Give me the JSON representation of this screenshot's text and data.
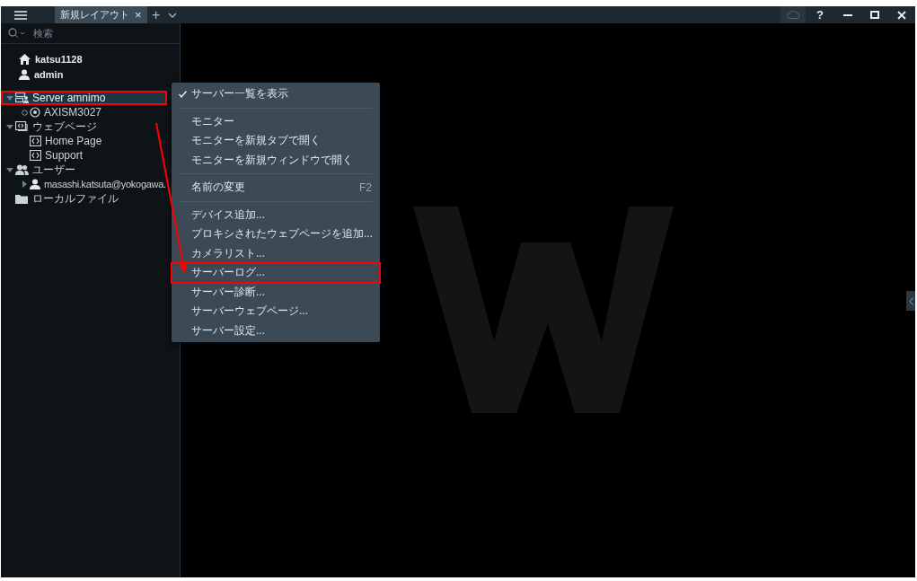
{
  "titlebar": {
    "tabs": [
      {
        "label": "新規レイアウト",
        "selected": true,
        "close": "×"
      }
    ],
    "add": "+",
    "help": "?"
  },
  "sidebar": {
    "search": {
      "placeholder": "検索"
    },
    "account": [
      {
        "kind": "home",
        "text": "katsu1128"
      },
      {
        "kind": "user",
        "text": "admin"
      }
    ],
    "tree": [
      {
        "kind": "server",
        "label": "Server amnimo",
        "expanded": true,
        "selected": true,
        "highlighted": true,
        "children": [
          {
            "kind": "camera",
            "label": "AXISM3027",
            "selected": false,
            "highlighted": false
          }
        ]
      },
      {
        "kind": "webpages",
        "label": "ウェブページ",
        "expanded": true,
        "selected": false,
        "highlighted": false,
        "children": [
          {
            "kind": "webpage",
            "label": "Home Page",
            "selected": false,
            "highlighted": false
          },
          {
            "kind": "webpage",
            "label": "Support",
            "selected": false,
            "highlighted": false
          }
        ]
      },
      {
        "kind": "users",
        "label": "ユーザー",
        "expanded": true,
        "selected": false,
        "highlighted": false,
        "children": [
          {
            "kind": "user",
            "label": "masashi.katsuta@yokogawa.",
            "expanded": false,
            "selected": false,
            "highlighted": false
          }
        ]
      },
      {
        "kind": "folder",
        "label": "ローカルファイル",
        "selected": false,
        "highlighted": false
      }
    ]
  },
  "context_menu": {
    "groups": [
      [
        {
          "label": "サーバー一覧を表示",
          "checked": true,
          "highlighted": false
        }
      ],
      [
        {
          "label": "モニター",
          "checked": false,
          "highlighted": false
        },
        {
          "label": "モニターを新規タブで開く",
          "checked": false,
          "highlighted": false
        },
        {
          "label": "モニターを新規ウィンドウで開く",
          "checked": false,
          "highlighted": false
        }
      ],
      [
        {
          "label": "名前の変更",
          "shortcut": "F2",
          "checked": false,
          "highlighted": false
        }
      ],
      [
        {
          "label": "デバイス追加...",
          "checked": false,
          "highlighted": false
        },
        {
          "label": "プロキシされたウェブページを追加...",
          "checked": false,
          "highlighted": false
        },
        {
          "label": "カメラリスト...",
          "checked": false,
          "highlighted": false
        },
        {
          "label": "サーバーログ...",
          "checked": false,
          "highlighted": true
        },
        {
          "label": "サーバー診断...",
          "checked": false,
          "highlighted": false
        },
        {
          "label": "サーバーウェブページ...",
          "checked": false,
          "highlighted": false
        },
        {
          "label": "サーバー設定...",
          "checked": false,
          "highlighted": false
        }
      ]
    ]
  }
}
